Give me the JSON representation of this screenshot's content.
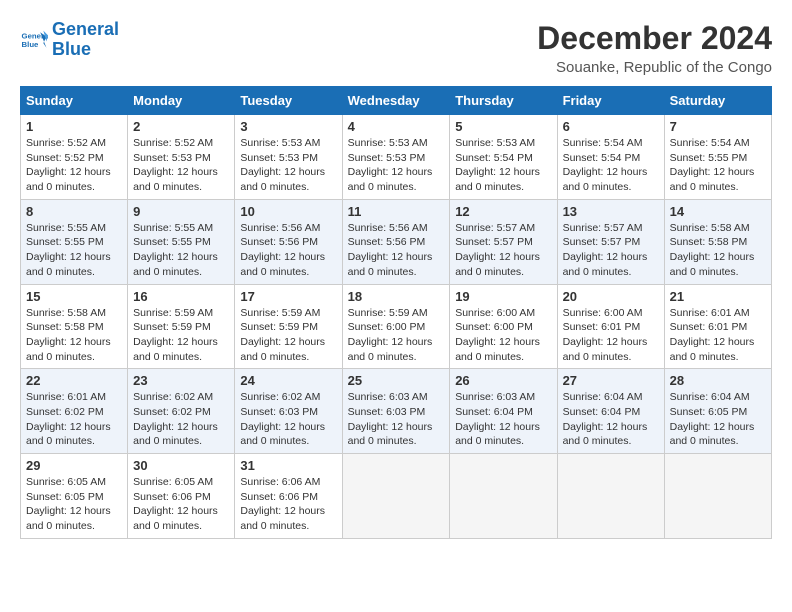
{
  "logo": {
    "line1": "General",
    "line2": "Blue"
  },
  "title": "December 2024",
  "subtitle": "Souanke, Republic of the Congo",
  "days_of_week": [
    "Sunday",
    "Monday",
    "Tuesday",
    "Wednesday",
    "Thursday",
    "Friday",
    "Saturday"
  ],
  "weeks": [
    [
      {
        "day": "1",
        "sunrise": "5:52 AM",
        "sunset": "5:52 PM",
        "daylight": "12 hours and 0 minutes."
      },
      {
        "day": "2",
        "sunrise": "5:52 AM",
        "sunset": "5:53 PM",
        "daylight": "12 hours and 0 minutes."
      },
      {
        "day": "3",
        "sunrise": "5:53 AM",
        "sunset": "5:53 PM",
        "daylight": "12 hours and 0 minutes."
      },
      {
        "day": "4",
        "sunrise": "5:53 AM",
        "sunset": "5:53 PM",
        "daylight": "12 hours and 0 minutes."
      },
      {
        "day": "5",
        "sunrise": "5:53 AM",
        "sunset": "5:54 PM",
        "daylight": "12 hours and 0 minutes."
      },
      {
        "day": "6",
        "sunrise": "5:54 AM",
        "sunset": "5:54 PM",
        "daylight": "12 hours and 0 minutes."
      },
      {
        "day": "7",
        "sunrise": "5:54 AM",
        "sunset": "5:55 PM",
        "daylight": "12 hours and 0 minutes."
      }
    ],
    [
      {
        "day": "8",
        "sunrise": "5:55 AM",
        "sunset": "5:55 PM",
        "daylight": "12 hours and 0 minutes."
      },
      {
        "day": "9",
        "sunrise": "5:55 AM",
        "sunset": "5:55 PM",
        "daylight": "12 hours and 0 minutes."
      },
      {
        "day": "10",
        "sunrise": "5:56 AM",
        "sunset": "5:56 PM",
        "daylight": "12 hours and 0 minutes."
      },
      {
        "day": "11",
        "sunrise": "5:56 AM",
        "sunset": "5:56 PM",
        "daylight": "12 hours and 0 minutes."
      },
      {
        "day": "12",
        "sunrise": "5:57 AM",
        "sunset": "5:57 PM",
        "daylight": "12 hours and 0 minutes."
      },
      {
        "day": "13",
        "sunrise": "5:57 AM",
        "sunset": "5:57 PM",
        "daylight": "12 hours and 0 minutes."
      },
      {
        "day": "14",
        "sunrise": "5:58 AM",
        "sunset": "5:58 PM",
        "daylight": "12 hours and 0 minutes."
      }
    ],
    [
      {
        "day": "15",
        "sunrise": "5:58 AM",
        "sunset": "5:58 PM",
        "daylight": "12 hours and 0 minutes."
      },
      {
        "day": "16",
        "sunrise": "5:59 AM",
        "sunset": "5:59 PM",
        "daylight": "12 hours and 0 minutes."
      },
      {
        "day": "17",
        "sunrise": "5:59 AM",
        "sunset": "5:59 PM",
        "daylight": "12 hours and 0 minutes."
      },
      {
        "day": "18",
        "sunrise": "5:59 AM",
        "sunset": "6:00 PM",
        "daylight": "12 hours and 0 minutes."
      },
      {
        "day": "19",
        "sunrise": "6:00 AM",
        "sunset": "6:00 PM",
        "daylight": "12 hours and 0 minutes."
      },
      {
        "day": "20",
        "sunrise": "6:00 AM",
        "sunset": "6:01 PM",
        "daylight": "12 hours and 0 minutes."
      },
      {
        "day": "21",
        "sunrise": "6:01 AM",
        "sunset": "6:01 PM",
        "daylight": "12 hours and 0 minutes."
      }
    ],
    [
      {
        "day": "22",
        "sunrise": "6:01 AM",
        "sunset": "6:02 PM",
        "daylight": "12 hours and 0 minutes."
      },
      {
        "day": "23",
        "sunrise": "6:02 AM",
        "sunset": "6:02 PM",
        "daylight": "12 hours and 0 minutes."
      },
      {
        "day": "24",
        "sunrise": "6:02 AM",
        "sunset": "6:03 PM",
        "daylight": "12 hours and 0 minutes."
      },
      {
        "day": "25",
        "sunrise": "6:03 AM",
        "sunset": "6:03 PM",
        "daylight": "12 hours and 0 minutes."
      },
      {
        "day": "26",
        "sunrise": "6:03 AM",
        "sunset": "6:04 PM",
        "daylight": "12 hours and 0 minutes."
      },
      {
        "day": "27",
        "sunrise": "6:04 AM",
        "sunset": "6:04 PM",
        "daylight": "12 hours and 0 minutes."
      },
      {
        "day": "28",
        "sunrise": "6:04 AM",
        "sunset": "6:05 PM",
        "daylight": "12 hours and 0 minutes."
      }
    ],
    [
      {
        "day": "29",
        "sunrise": "6:05 AM",
        "sunset": "6:05 PM",
        "daylight": "12 hours and 0 minutes."
      },
      {
        "day": "30",
        "sunrise": "6:05 AM",
        "sunset": "6:06 PM",
        "daylight": "12 hours and 0 minutes."
      },
      {
        "day": "31",
        "sunrise": "6:06 AM",
        "sunset": "6:06 PM",
        "daylight": "12 hours and 0 minutes."
      },
      null,
      null,
      null,
      null
    ]
  ],
  "labels": {
    "sunrise": "Sunrise:",
    "sunset": "Sunset:",
    "daylight": "Daylight:"
  }
}
